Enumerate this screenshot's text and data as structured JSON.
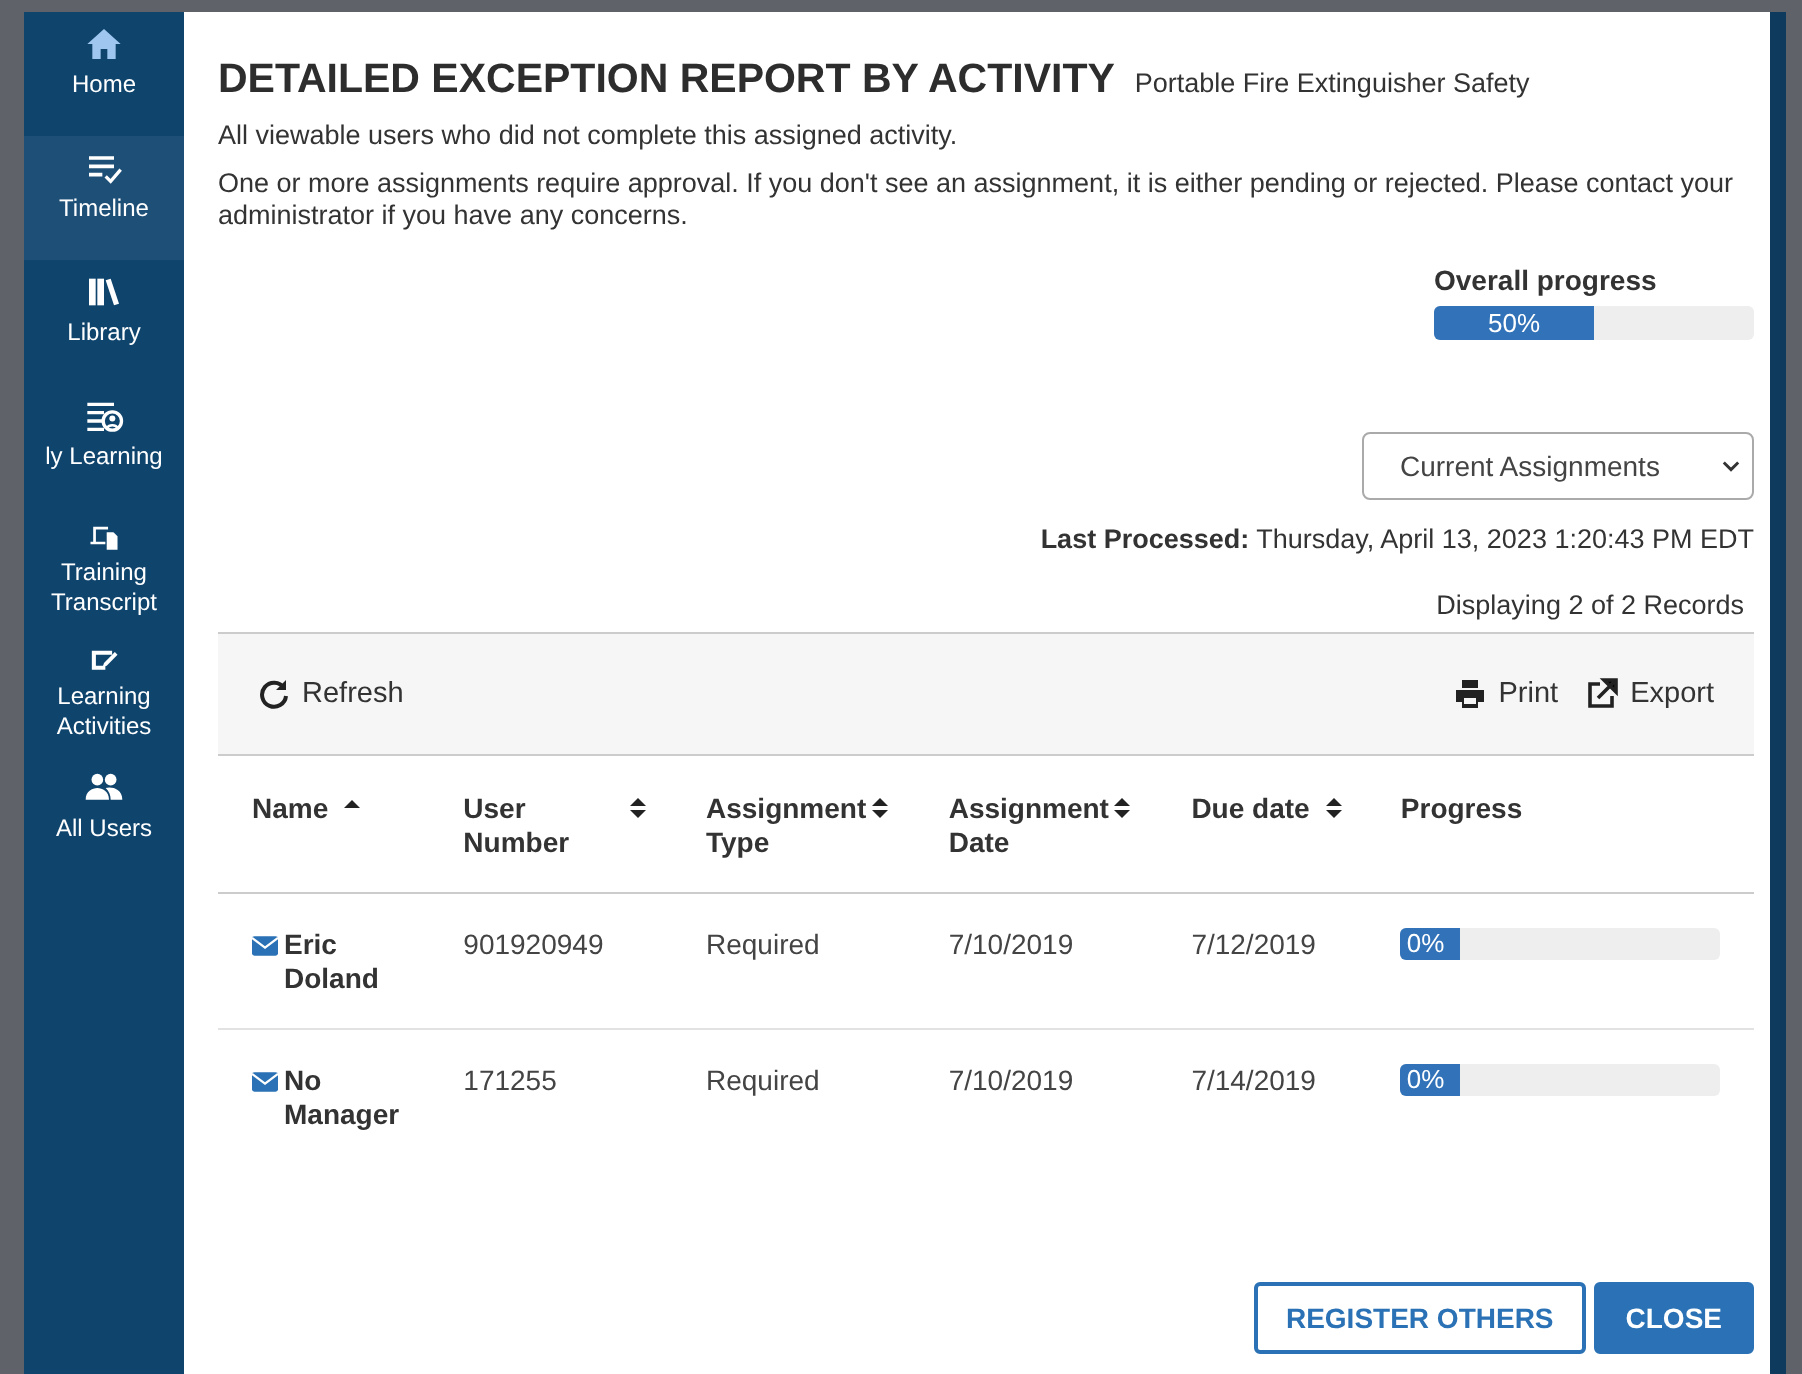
{
  "sidebar": {
    "items": [
      {
        "label": "Home",
        "kind": "home",
        "selected": false
      },
      {
        "label": "Timeline",
        "kind": "timeline",
        "selected": true
      },
      {
        "label": "Library",
        "kind": "library",
        "selected": false
      },
      {
        "label": "ly Learning",
        "kind": "learning",
        "selected": false
      },
      {
        "label": "Training Transcript",
        "kind": "transcript",
        "selected": false
      },
      {
        "label": "Learning Activities",
        "kind": "activities",
        "selected": false
      },
      {
        "label": "All Users",
        "kind": "users",
        "selected": false
      }
    ]
  },
  "report": {
    "title": "DETAILED EXCEPTION REPORT BY ACTIVITY",
    "subtitle": "Portable Fire Extinguisher Safety",
    "description": "All viewable users who did not complete this assigned activity.",
    "notice": "One or more assignments require approval. If you don't see an assignment, it is either pending or rejected. Please contact your administrator if you have any concerns.",
    "overall_progress": {
      "label": "Overall progress",
      "level": 0.5,
      "reading": "50%"
    },
    "filter": {
      "value": "Current Assignments"
    },
    "last_processed": "**Last Processed:** Thursday, April 13, 2023 1:20:43 PM EDT",
    "record_count": "Displaying 2 of 2 Records",
    "toolbar": {
      "refresh": "Refresh",
      "print": "Print",
      "export": "Export"
    }
  },
  "table": {
    "columns": [
      {
        "label": "Name",
        "sorted": true
      },
      {
        "label": "User Number",
        "sortable": true,
        "sorted": false
      },
      {
        "label": "Assignment Type",
        "sortable": true,
        "sorted": false
      },
      {
        "label": "Assignment Date",
        "sortable": true,
        "sorted": false
      },
      {
        "label": "Due date",
        "sortable": true,
        "sorted": false
      },
      {
        "label": "Progress",
        "sortable": false,
        "sorted": false
      }
    ],
    "rows": [
      {
        "name": "Eric Doland",
        "user_number": "901920949",
        "type": "Required",
        "assigned": "7/10/2019",
        "due": "7/12/2019",
        "reading": "0%"
      },
      {
        "name": "No Manager",
        "user_number": "171255",
        "type": "Required",
        "assigned": "7/10/2019",
        "due": "7/14/2019",
        "reading": "0%"
      }
    ]
  },
  "buttons": [
    {
      "label": "REGISTER OTHERS",
      "kind": "secondary"
    },
    {
      "label": "CLOSE",
      "kind": "primary"
    }
  ]
}
